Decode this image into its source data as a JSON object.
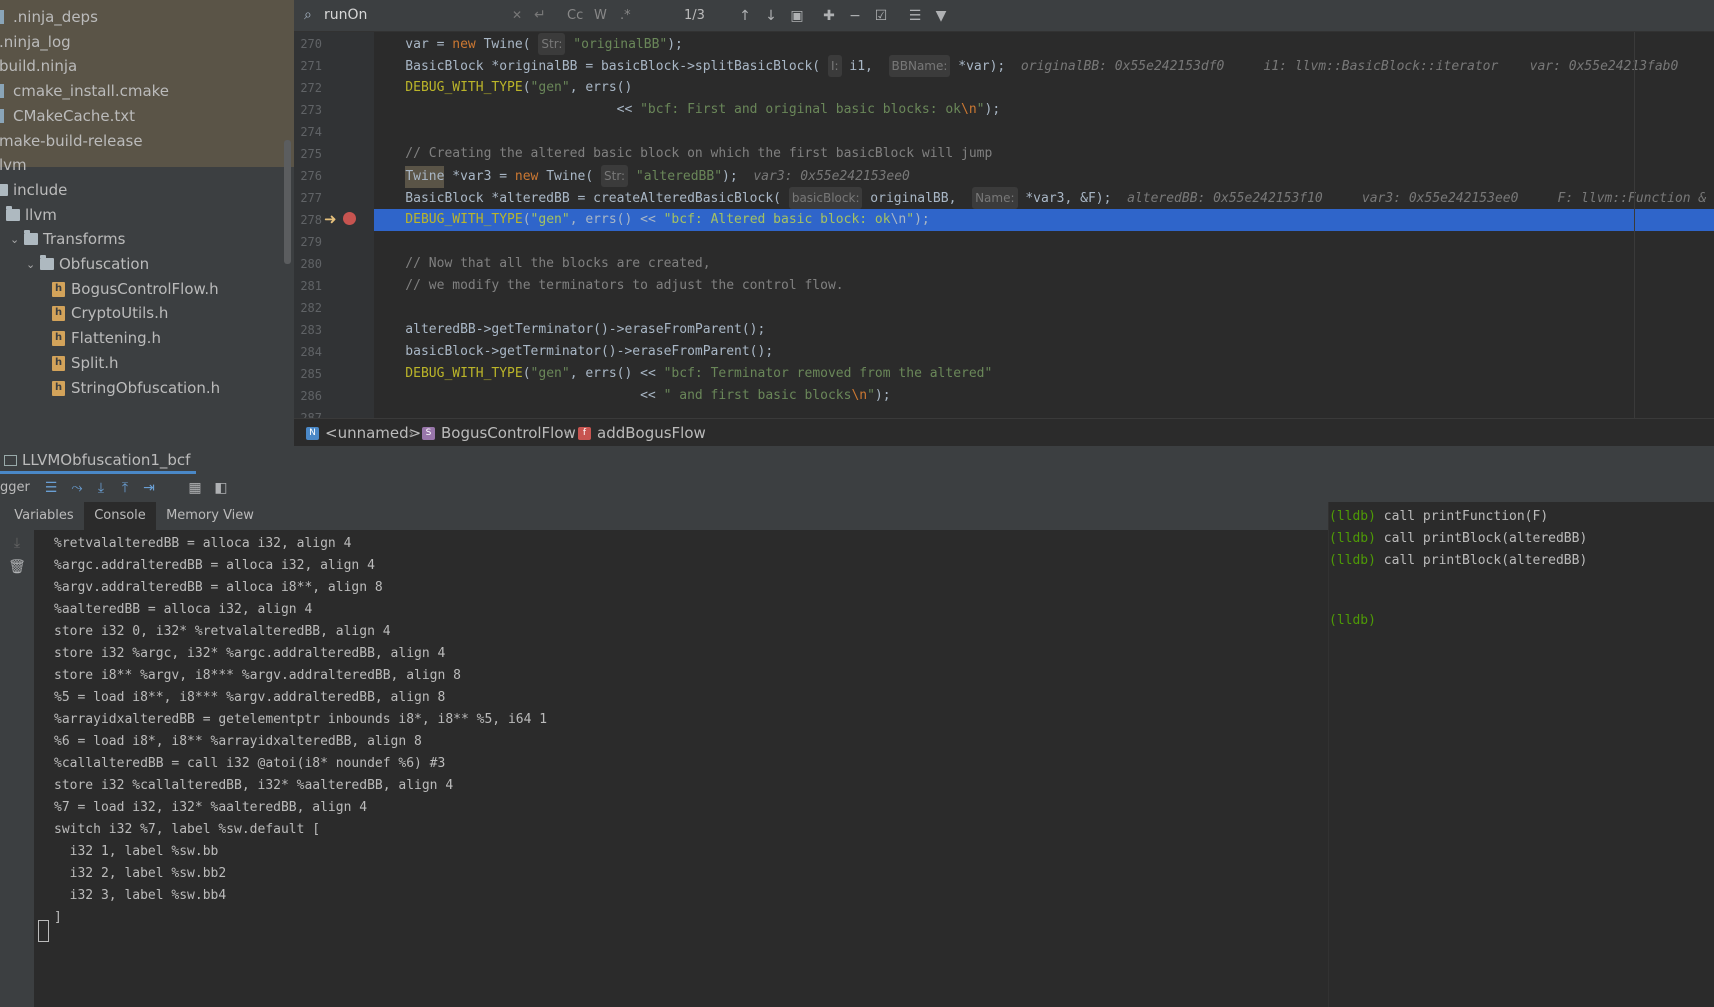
{
  "colors": {
    "accent": "#2f65ca",
    "keyword": "#cc7832",
    "string": "#6a8759",
    "comment": "#808080",
    "breakpoint": "#c75450",
    "lldb_prompt": "#4e9a06"
  },
  "tree": {
    "items": [
      {
        "label": ".ninja_deps",
        "icon": "file-icon"
      },
      {
        "label": ".ninja_log",
        "icon": "file-icon"
      },
      {
        "label": "build.ninja",
        "icon": "file-icon"
      },
      {
        "label": "cmake_install.cmake",
        "icon": "file-icon"
      },
      {
        "label": "CMakeCache.txt",
        "icon": "file-icon"
      },
      {
        "label": "make-build-release",
        "icon": "folder-icon"
      },
      {
        "label": "lvm",
        "icon": "folder-icon"
      },
      {
        "label": "include",
        "icon": "folder-icon"
      },
      {
        "label": "llvm",
        "icon": "folder-icon"
      },
      {
        "label": "Transforms",
        "icon": "folder-icon"
      },
      {
        "label": "Obfuscation",
        "icon": "folder-icon"
      },
      {
        "label": "BogusControlFlow.h",
        "icon": "header-file-icon"
      },
      {
        "label": "CryptoUtils.h",
        "icon": "header-file-icon"
      },
      {
        "label": "Flattening.h",
        "icon": "header-file-icon"
      },
      {
        "label": "Split.h",
        "icon": "header-file-icon"
      },
      {
        "label": "StringObfuscation.h",
        "icon": "header-file-icon"
      }
    ]
  },
  "search": {
    "query": "runOn",
    "match_count": "1/3",
    "opt_case": "Cc",
    "opt_word": "W",
    "opt_regex": ".*"
  },
  "editor": {
    "lines": [
      {
        "num": "270",
        "tokens": [
          [
            "",
            "    var = "
          ],
          [
            "kw",
            "new "
          ],
          [
            "",
            "Twine( "
          ],
          [
            "hint",
            "Str:"
          ],
          [
            "str",
            " \"originalBB\""
          ],
          [
            "",
            ");"
          ]
        ]
      },
      {
        "num": "271",
        "tokens": [
          [
            "",
            "    BasicBlock *originalBB = basicBlock->splitBasicBlock( "
          ],
          [
            "hint",
            "I:"
          ],
          [
            "",
            " i1,  "
          ],
          [
            "hint",
            "BBName:"
          ],
          [
            "",
            " *var);  "
          ],
          [
            "inl",
            "originalBB: 0x55e242153df0     i1: llvm::BasicBlock::iterator    var: 0x55e24213fab0"
          ]
        ]
      },
      {
        "num": "272",
        "tokens": [
          [
            "mac",
            "    DEBUG_WITH_TYPE"
          ],
          [
            "",
            "("
          ],
          [
            "str",
            "\"gen\""
          ],
          [
            "",
            ", errs()"
          ]
        ]
      },
      {
        "num": "273",
        "tokens": [
          [
            "",
            "                               << "
          ],
          [
            "str",
            "\"bcf: First and original basic blocks: ok"
          ],
          [
            "esc",
            "\\n"
          ],
          [
            "str",
            "\""
          ],
          [
            "",
            ");"
          ]
        ]
      },
      {
        "num": "274",
        "tokens": [
          [
            "",
            ""
          ]
        ]
      },
      {
        "num": "275",
        "tokens": [
          [
            "cm",
            "    // Creating the altered basic block on which the first basicBlock will jump"
          ]
        ]
      },
      {
        "num": "276",
        "tokens": [
          [
            "",
            "    "
          ],
          [
            "tyhl",
            "Twine"
          ],
          [
            "",
            " *var3 = "
          ],
          [
            "kw",
            "new "
          ],
          [
            "",
            "Twine( "
          ],
          [
            "hint",
            "Str:"
          ],
          [
            "str",
            " \"alteredBB\""
          ],
          [
            "",
            ");  "
          ],
          [
            "inl",
            "var3: 0x55e242153ee0"
          ]
        ]
      },
      {
        "num": "277",
        "tokens": [
          [
            "",
            "    BasicBlock *alteredBB = createAlteredBasicBlock( "
          ],
          [
            "hint",
            "basicBlock:"
          ],
          [
            "",
            " originalBB,  "
          ],
          [
            "hint",
            "Name:"
          ],
          [
            "",
            " *var3, &F);  "
          ],
          [
            "inl",
            "alteredBB: 0x55e242153f10     var3: 0x55e242153ee0     F: llvm::Function &"
          ]
        ]
      },
      {
        "num": "278",
        "tokens": [
          [
            "mac",
            "    DEBUG_WITH_TYPE"
          ],
          [
            "",
            "("
          ],
          [
            "str",
            "\"gen\""
          ],
          [
            "",
            ", errs() << "
          ],
          [
            "str",
            "\"bcf: Altered basic block: ok"
          ],
          [
            "esc",
            "\\n"
          ],
          [
            "str",
            "\""
          ],
          [
            "",
            ");"
          ]
        ]
      },
      {
        "num": "279",
        "tokens": [
          [
            "",
            ""
          ]
        ]
      },
      {
        "num": "280",
        "tokens": [
          [
            "cm",
            "    // Now that all the blocks are created,"
          ]
        ]
      },
      {
        "num": "281",
        "tokens": [
          [
            "cm",
            "    // we modify the terminators to adjust the control flow."
          ]
        ]
      },
      {
        "num": "282",
        "tokens": [
          [
            "",
            ""
          ]
        ]
      },
      {
        "num": "283",
        "tokens": [
          [
            "",
            "    alteredBB->getTerminator()->eraseFromParent();"
          ]
        ]
      },
      {
        "num": "284",
        "tokens": [
          [
            "",
            "    basicBlock->getTerminator()->eraseFromParent();"
          ]
        ]
      },
      {
        "num": "285",
        "tokens": [
          [
            "mac",
            "    DEBUG_WITH_TYPE"
          ],
          [
            "",
            "("
          ],
          [
            "str",
            "\"gen\""
          ],
          [
            "",
            ", errs() << "
          ],
          [
            "str",
            "\"bcf: Terminator removed from the altered\""
          ]
        ]
      },
      {
        "num": "286",
        "tokens": [
          [
            "",
            "                                  << "
          ],
          [
            "str",
            "\" and first basic blocks"
          ],
          [
            "esc",
            "\\n"
          ],
          [
            "str",
            "\""
          ],
          [
            "",
            ");"
          ]
        ]
      },
      {
        "num": "287",
        "tokens": [
          [
            "",
            ""
          ]
        ]
      }
    ],
    "current_line": "278"
  },
  "breadcrumb": {
    "items": [
      {
        "label": "<unnamed>",
        "badge": "N",
        "color": "#4a88c7"
      },
      {
        "label": "BogusControlFlow",
        "badge": "S",
        "color": "#9876aa"
      },
      {
        "label": "addBogusFlow",
        "badge": "f",
        "color": "#c75450"
      }
    ]
  },
  "debug": {
    "session_tab": "LLVMObfuscation1_bcf",
    "toolbar_label": "gger",
    "subtabs": [
      "Variables",
      "Console",
      "Memory View"
    ],
    "active_subtab": "Console",
    "console_lines": [
      "%retvalalteredBB = alloca i32, align 4",
      "%argc.addralteredBB = alloca i32, align 4",
      "%argv.addralteredBB = alloca i8**, align 8",
      "%aalteredBB = alloca i32, align 4",
      "store i32 0, i32* %retvalalteredBB, align 4",
      "store i32 %argc, i32* %argc.addralteredBB, align 4",
      "store i8** %argv, i8*** %argv.addralteredBB, align 8",
      "%5 = load i8**, i8*** %argv.addralteredBB, align 8",
      "%arrayidxalteredBB = getelementptr inbounds i8*, i8** %5, i64 1",
      "%6 = load i8*, i8** %arrayidxalteredBB, align 8",
      "%callalteredBB = call i32 @atoi(i8* noundef %6) #3",
      "store i32 %callalteredBB, i32* %aalteredBB, align 4",
      "%7 = load i32, i32* %aalteredBB, align 4",
      "switch i32 %7, label %sw.default [",
      "  i32 1, label %sw.bb",
      "  i32 2, label %sw.bb2",
      "  i32 3, label %sw.bb4",
      "]"
    ],
    "lldb_prompt": "(lldb)",
    "lldb_lines": [
      {
        "prompt": "(lldb)",
        "cmd": " call printFunction(F)"
      },
      {
        "prompt": "(lldb)",
        "cmd": " call printBlock(alteredBB)"
      },
      {
        "prompt": "(lldb)",
        "cmd": " call printBlock(alteredBB)"
      }
    ]
  }
}
